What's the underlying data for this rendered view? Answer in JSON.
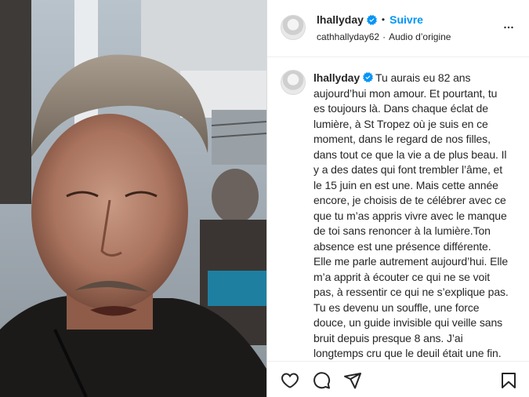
{
  "post": {
    "username": "lhallyday",
    "follow_label": "Suivre",
    "separator": "•",
    "audio_user": "cathhallyday62",
    "audio_separator": "·",
    "audio_label": "Audio d’origine"
  },
  "caption": {
    "username": "lhallyday",
    "text": "Tu aurais eu 82 ans aujourd’hui mon amour. Et pourtant, tu es toujours là. Dans chaque éclat de lumière, à St Tropez où je suis en ce moment, dans le regard de nos filles, dans tout ce que la vie a de plus beau. Il y a des dates qui font trembler l’âme, et le 15 juin en est une. Mais cette année encore, je choisis de te célébrer avec ce que tu m’as appris vivre avec le manque de toi sans renoncer à la lumière.Ton absence est une présence différente. Elle me parle autrement aujourd’hui. Elle m’a apprit à écouter ce qui ne se voit pas, à ressentir ce qui ne s’explique pas. Tu es devenu un souffle, une force douce, un guide invisible qui veille sans bruit depuis presque 8 ans. J’ai longtemps cru que le deuil était une fin. Mais j’ai compris que l’amour, le vrai, ne"
  },
  "icons": {
    "verified": "verified-badge-icon",
    "more": "more-options-icon",
    "like": "heart-icon",
    "comment": "comment-icon",
    "share": "send-icon",
    "save": "bookmark-icon"
  },
  "colors": {
    "accent": "#0095f6",
    "text": "#262626",
    "border": "#dbdbdb"
  }
}
